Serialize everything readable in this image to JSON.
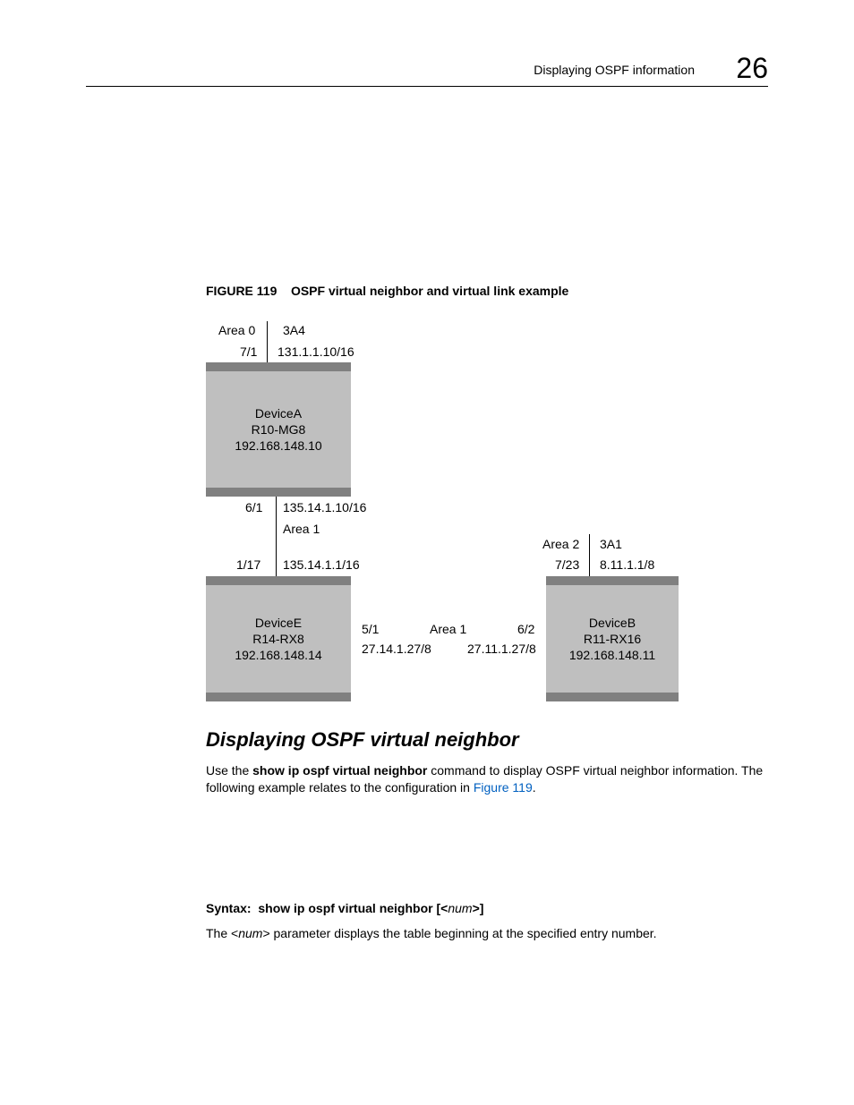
{
  "header": {
    "title": "Displaying OSPF information",
    "chapter": "26"
  },
  "figure": {
    "label": "FIGURE 119",
    "caption": "OSPF virtual neighbor and virtual link example"
  },
  "diagram": {
    "deviceA": {
      "name": "DeviceA",
      "model": "R10-MG8",
      "ip": "192.168.148.10",
      "top": {
        "area": "Area 0",
        "code": "3A4",
        "port": "7/1",
        "net": "131.1.1.10/16"
      },
      "bot": {
        "port": "6/1",
        "net": "135.14.1.10/16",
        "area": "Area 1"
      }
    },
    "deviceE": {
      "name": "DeviceE",
      "model": "R14-RX8",
      "ip": "192.168.148.14",
      "top": {
        "port": "1/17",
        "net": "135.14.1.1/16"
      },
      "right": {
        "port": "5/1",
        "net": "27.14.1.27/8"
      }
    },
    "deviceB": {
      "name": "DeviceB",
      "model": "R11-RX16",
      "ip": "192.168.148.11",
      "top": {
        "area": "Area 2",
        "code": "3A1",
        "port": "7/23",
        "net": "8.11.1.1/8"
      },
      "left": {
        "port": "6/2",
        "net": "27.11.1.27/8"
      }
    },
    "midArea": "Area 1"
  },
  "section": {
    "heading": "Displaying OSPF virtual neighbor",
    "p1_pre": "Use the ",
    "p1_cmd": "show ip ospf virtual neighbor",
    "p1_mid": " command to display OSPF virtual neighbor information. The following example relates to the configuration in ",
    "p1_link": "Figure 119",
    "p1_post": "."
  },
  "syntax": {
    "label": "Syntax:",
    "cmd": "show ip ospf virtual neighbor [<",
    "param": "num",
    "cmd_end": ">]"
  },
  "p2_pre": "The <",
  "p2_param": "num",
  "p2_post": "> parameter displays the table beginning at the specified entry number."
}
